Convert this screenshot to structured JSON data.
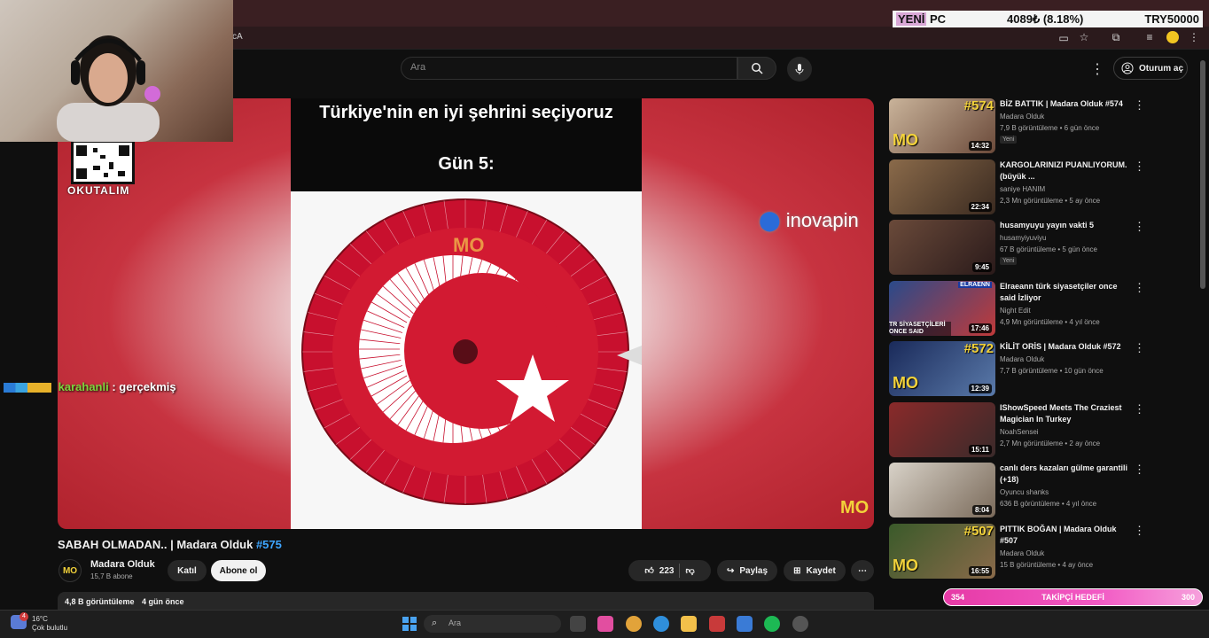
{
  "browser": {
    "address_fragment": "cA"
  },
  "ticker": {
    "label_hl": "YENİ",
    "label": "PC",
    "value": "4089₺ (8.18%)",
    "target": "TRY50000"
  },
  "header": {
    "search_placeholder": "Ara",
    "signin_label": "Oturum aç"
  },
  "player": {
    "title_line1": "Türkiye'nin en iyi şehrini seçiyoruz",
    "title_line2": "Gün 5:",
    "qr_label": "OKUTALIM",
    "brand": "inovapin",
    "corner_logo": "MO",
    "wheel_logo": "MO"
  },
  "chat": {
    "user": "karahanli",
    "message": ": gerçekmiş"
  },
  "video": {
    "title": "SABAH OLMADAN.. | Madara Olduk",
    "hashtag": "#575",
    "channel": "Madara Olduk",
    "channel_avatar": "MO",
    "subscribers": "15,7 B abone",
    "join_label": "Katıl",
    "subscribe_label": "Abone ol",
    "likes": "223",
    "share_label": "Paylaş",
    "save_label": "Kaydet",
    "views": "4,8 B görüntüleme",
    "age": "4 gün önce"
  },
  "recommendations": [
    {
      "title": "BİZ BATTIK | Madara Olduk #574",
      "channel": "Madara Olduk",
      "meta": "7,9 B görüntüleme • 6 gün önce",
      "badge": "Yeni",
      "duration": "14:32",
      "overlay_num": "#574",
      "overlay_logo": "MO"
    },
    {
      "title": "KARGOLARINIZI PUANLIYORUM. (büyük ...",
      "channel": "saniye HANIM",
      "meta": "2,3 Mn görüntüleme • 5 ay önce",
      "badge": "",
      "duration": "22:34",
      "overlay_num": "",
      "overlay_logo": ""
    },
    {
      "title": "husamyuyu yayın vakti 5",
      "channel": "husamyiyuviyu",
      "meta": "67 B görüntüleme • 5 gün önce",
      "badge": "Yeni",
      "duration": "9:45",
      "overlay_num": "",
      "overlay_logo": ""
    },
    {
      "title": "Elraeann türk siyasetçiler once said İzliyor",
      "channel": "Night Edit",
      "meta": "4,9 Mn görüntüleme • 4 yıl önce",
      "badge": "",
      "duration": "17:46",
      "overlay_num": "",
      "overlay_logo": "",
      "thumb_text_top": "ELRAENN",
      "thumb_text_bottom": "TR SİYASETÇİLERİ ONCE SAID"
    },
    {
      "title": "KİLİT ORİS | Madara Olduk #572",
      "channel": "Madara Olduk",
      "meta": "7,7 B görüntüleme • 10 gün önce",
      "badge": "",
      "duration": "12:39",
      "overlay_num": "#572",
      "overlay_logo": "MO"
    },
    {
      "title": "IShowSpeed Meets The Craziest Magician In Turkey",
      "channel": "NoahSensei",
      "meta": "2,7 Mn görüntüleme • 2 ay önce",
      "badge": "",
      "duration": "15:11",
      "overlay_num": "",
      "overlay_logo": ""
    },
    {
      "title": "canlı ders kazaları gülme garantili (+18)",
      "channel": "Oyuncu shanks",
      "meta": "636 B görüntüleme • 4 yıl önce",
      "badge": "",
      "duration": "8:04",
      "overlay_num": "",
      "overlay_logo": ""
    },
    {
      "title": "PITTIK BOĞAN | Madara Olduk #507",
      "channel": "Madara Olduk",
      "meta": "15 B görüntüleme • 4 ay önce",
      "badge": "",
      "duration": "16:55",
      "overlay_num": "#507",
      "overlay_logo": "MO"
    }
  ],
  "goal": {
    "current": "354",
    "label": "TAKİPÇİ HEDEFİ",
    "target": "300"
  },
  "taskbar": {
    "temp": "16°C",
    "weather": "Çok bulutlu",
    "search_placeholder": "Ara",
    "weather_badge": "4"
  }
}
